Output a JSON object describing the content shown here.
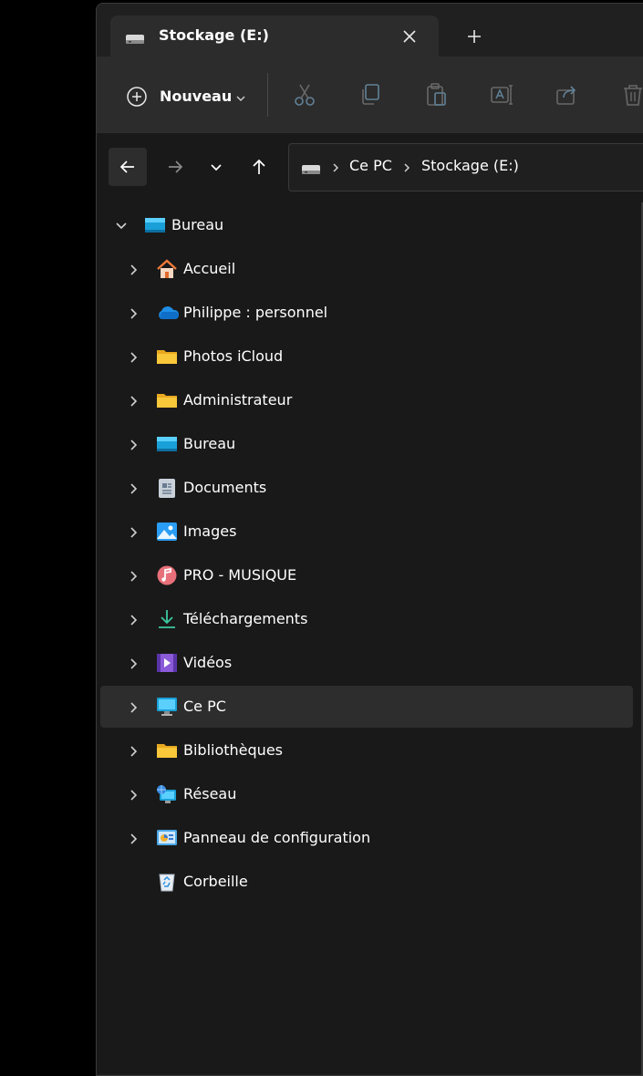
{
  "tab": {
    "title": "Stockage (E:)",
    "icon": "drive-icon"
  },
  "commandbar": {
    "new_label": "Nouveau",
    "icons": [
      "cut-icon",
      "copy-icon",
      "paste-icon",
      "rename-icon",
      "share-icon",
      "delete-icon"
    ]
  },
  "address": {
    "segments": [
      "Ce PC",
      "Stockage (E:)"
    ]
  },
  "tree": {
    "root": {
      "label": "Bureau",
      "icon": "desktop-icon",
      "expanded": true
    },
    "items": [
      {
        "label": "Accueil",
        "icon": "home-icon",
        "has_children": true
      },
      {
        "label": "Philippe : personnel",
        "icon": "onedrive-cloud-icon",
        "has_children": true
      },
      {
        "label": "Photos iCloud",
        "icon": "folder-icon",
        "has_children": true
      },
      {
        "label": "Administrateur",
        "icon": "folder-icon",
        "has_children": true
      },
      {
        "label": "Bureau",
        "icon": "desktop-icon",
        "has_children": true
      },
      {
        "label": "Documents",
        "icon": "documents-icon",
        "has_children": true
      },
      {
        "label": "Images",
        "icon": "pictures-icon",
        "has_children": true
      },
      {
        "label": "PRO - MUSIQUE",
        "icon": "music-icon",
        "has_children": true
      },
      {
        "label": "Téléchargements",
        "icon": "downloads-icon",
        "has_children": true
      },
      {
        "label": "Vidéos",
        "icon": "videos-icon",
        "has_children": true
      },
      {
        "label": "Ce PC",
        "icon": "this-pc-icon",
        "has_children": true,
        "selected": true
      },
      {
        "label": "Bibliothèques",
        "icon": "folder-icon",
        "has_children": true
      },
      {
        "label": "Réseau",
        "icon": "network-icon",
        "has_children": true
      },
      {
        "label": "Panneau de configuration",
        "icon": "control-panel-icon",
        "has_children": true
      },
      {
        "label": "Corbeille",
        "icon": "recycle-bin-icon",
        "has_children": false
      }
    ]
  },
  "colors": {
    "accent_cyan": "#4cc2ff",
    "folder_yellow": "#f8c73a",
    "selected_bg": "#2d2d2d"
  }
}
